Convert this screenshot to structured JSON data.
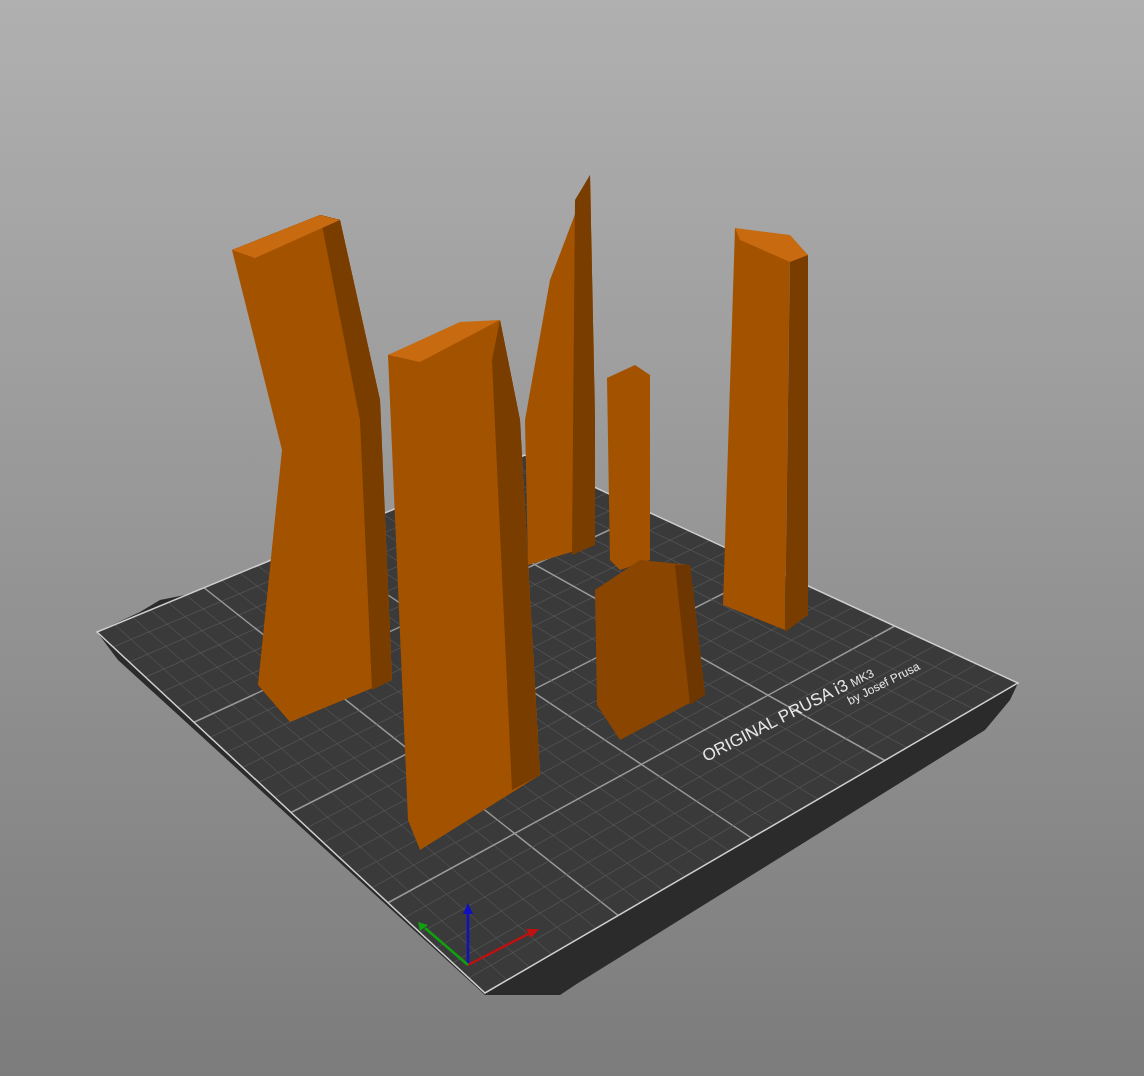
{
  "viewport": {
    "bed_label": {
      "title": "ORIGINAL PRUSA i3",
      "model": "MK3",
      "maker": "by Josef Prusa"
    }
  }
}
